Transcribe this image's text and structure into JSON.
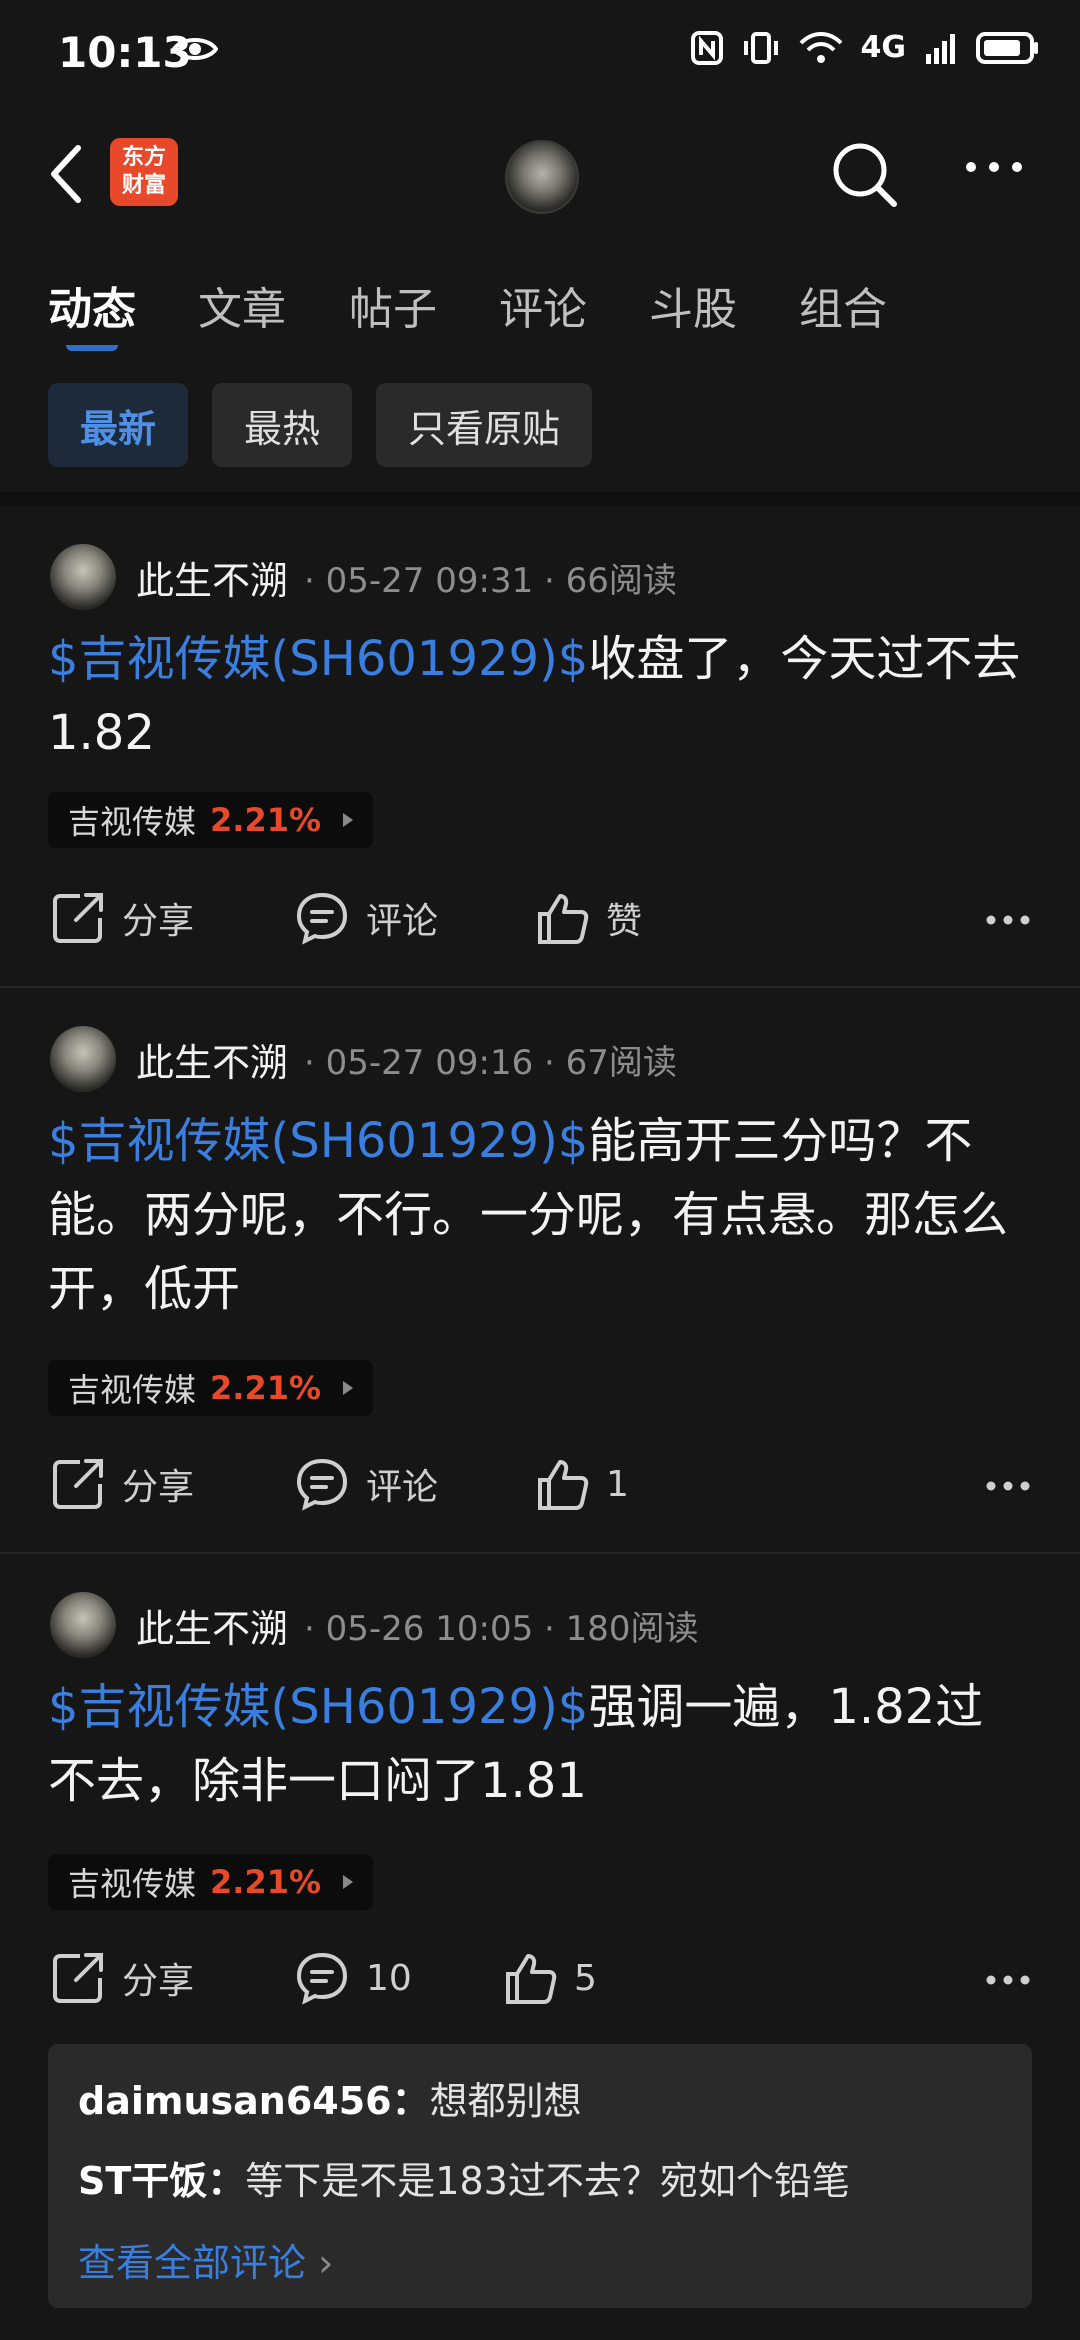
{
  "status": {
    "time": "10:13",
    "network": "4G"
  },
  "header": {
    "logo_text_line1": "东方",
    "logo_text_line2": "财富"
  },
  "tabs": [
    {
      "label": "动态",
      "active": true
    },
    {
      "label": "文章"
    },
    {
      "label": "帖子"
    },
    {
      "label": "评论"
    },
    {
      "label": "斗股"
    },
    {
      "label": "组合"
    }
  ],
  "filters": [
    {
      "label": "最新",
      "active": true
    },
    {
      "label": "最热"
    },
    {
      "label": "只看原贴"
    }
  ],
  "posts": [
    {
      "author": "此生不溯",
      "meta": "· 05-27 09:31 · 66阅读",
      "stock_link": "$吉视传媒(SH601929)$",
      "text": "收盘了，今天过不去1.82",
      "tag_name": "吉视传媒",
      "tag_pct": "2.21%",
      "share_label": "分享",
      "comment_label": "评论",
      "like_label": "赞"
    },
    {
      "author": "此生不溯",
      "meta": "· 05-27 09:16 · 67阅读",
      "stock_link": "$吉视传媒(SH601929)$",
      "text": "能高开三分吗？不能。两分呢，不行。一分呢，有点悬。那怎么开，低开",
      "tag_name": "吉视传媒",
      "tag_pct": "2.21%",
      "share_label": "分享",
      "comment_label": "评论",
      "like_label": "1"
    },
    {
      "author": "此生不溯",
      "meta": "· 05-26 10:05 · 180阅读",
      "stock_link": "$吉视传媒(SH601929)$",
      "text": "强调一遍，1.82过不去，除非一口闷了1.81",
      "tag_name": "吉视传媒",
      "tag_pct": "2.21%",
      "share_label": "分享",
      "comment_label": "10",
      "like_label": "5"
    }
  ],
  "comments": {
    "items": [
      {
        "user": "daimusan6456：",
        "text": "想都别想"
      },
      {
        "user": "ST干饭：",
        "text": "等下是不是183过不去？宛如个铅笔"
      }
    ],
    "view_all": "查看全部评论",
    "view_all_arrow": "›"
  },
  "colors": {
    "accent_blue": "#3a7fe0",
    "up_red": "#e8492b",
    "background": "#161616"
  }
}
